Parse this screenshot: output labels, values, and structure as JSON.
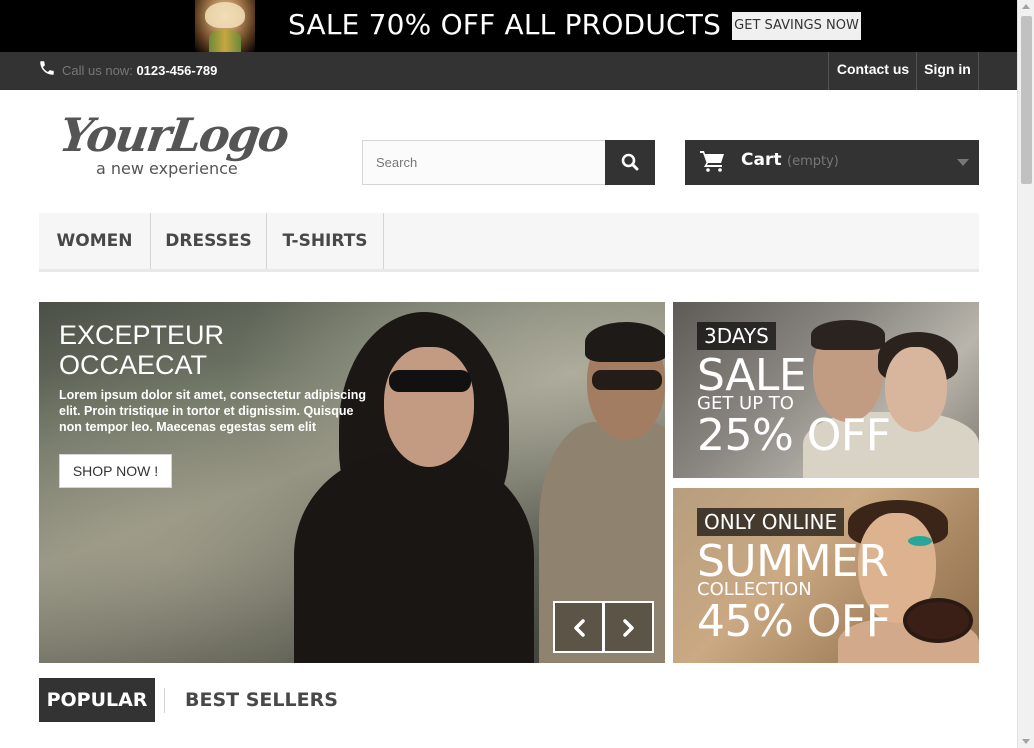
{
  "banner": {
    "headline": "SALE 70% OFF ALL PRODUCTS",
    "cta": "GET SAVINGS NOW"
  },
  "topbar": {
    "call_label": "Call us now:",
    "phone": "0123-456-789",
    "contact": "Contact us",
    "signin": "Sign in"
  },
  "logo": {
    "main": "YourLogo",
    "tagline": "a new experience"
  },
  "search": {
    "placeholder": "Search",
    "value": ""
  },
  "cart": {
    "label": "Cart",
    "status": "(empty)"
  },
  "menu": {
    "items": [
      "WOMEN",
      "DRESSES",
      "T-SHIRTS"
    ]
  },
  "slider": {
    "title_line1": "EXCEPTEUR",
    "title_line2": "OCCAECAT",
    "description": "Lorem ipsum dolor sit amet, consectetur adipiscing elit. Proin tristique in tortor et dignissim. Quisque non tempor leo. Maecenas egestas sem elit",
    "button": "SHOP NOW !"
  },
  "promo_top": {
    "tag": "3DAYS",
    "big": "SALE",
    "small": "GET UP TO",
    "offer": "25% OFF"
  },
  "promo_bottom": {
    "tag": "ONLY ONLINE",
    "big": "SUMMER",
    "small": "COLLECTION",
    "offer": "45% OFF"
  },
  "tabs": {
    "popular": "POPULAR",
    "best_sellers": "BEST SELLERS"
  },
  "colors": {
    "dark": "#333333",
    "menu_bg": "#f6f6f6",
    "text": "#484848"
  }
}
